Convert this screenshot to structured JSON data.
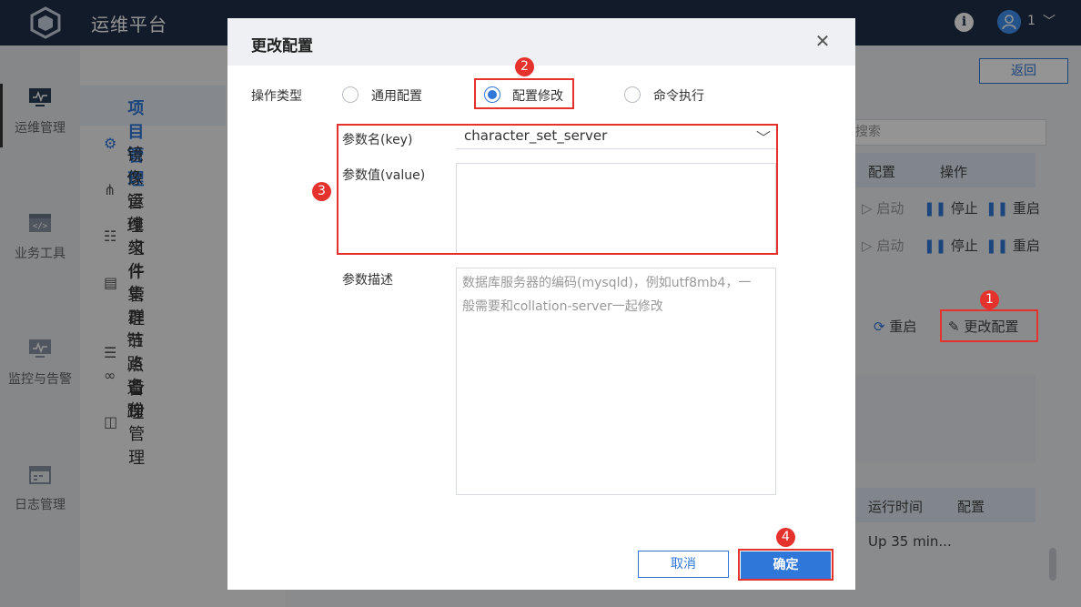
{
  "app": {
    "title": "运维平台",
    "user_name": "1"
  },
  "rail": {
    "items": [
      {
        "label": "运维管理",
        "icon": "monitor-icon"
      },
      {
        "label": "业务工具",
        "icon": "code-window-icon"
      },
      {
        "label": "监控与告警",
        "icon": "monitor-chart-icon"
      },
      {
        "label": "日志管理",
        "icon": "calendar-icon"
      }
    ]
  },
  "sidebar": {
    "items": [
      {
        "label": "项目管理",
        "icon": "gear-icon",
        "active": true
      },
      {
        "label": "镜像管理",
        "icon": "mirror-icon"
      },
      {
        "label": "运维组件",
        "icon": "cluster-icon"
      },
      {
        "label": "文件管理",
        "icon": "file-icon"
      },
      {
        "label": "集群节点管理",
        "icon": "sliders-icon"
      },
      {
        "label": "链路追踪",
        "icon": "trace-icon"
      },
      {
        "label": "备份管理",
        "icon": "backup-icon"
      }
    ]
  },
  "background": {
    "back_label": "返回",
    "search_placeholder": "搜索",
    "table1_headers": [
      "配置",
      "操作"
    ],
    "row_actions": [
      "启动",
      "停止",
      "重启"
    ],
    "panel_restart": "重启",
    "panel_change_config": "更改配置",
    "table2_headers": [
      "运行时间",
      "配置"
    ],
    "table2_cell": "Up 35 min..."
  },
  "modal": {
    "title": "更改配置",
    "op_type_label": "操作类型",
    "options": [
      "通用配置",
      "配置修改",
      "命令执行"
    ],
    "selected_option": "配置修改",
    "key_label": "参数名(key)",
    "key_value": "character_set_server",
    "value_label": "参数值(value)",
    "desc_label": "参数描述",
    "desc_text_line1": "数据库服务器的编码(mysqld)，例如utf8mb4，一",
    "desc_text_line2": "般需要和collation-server一起修改",
    "cancel_label": "取消",
    "confirm_label": "确定"
  },
  "annotations": {
    "badges": [
      "1",
      "2",
      "3",
      "4"
    ],
    "color": "#e5322d"
  },
  "colors": {
    "primary": "#2f77d8",
    "topbar": "#1f3049",
    "highlight": "#e5322d"
  }
}
